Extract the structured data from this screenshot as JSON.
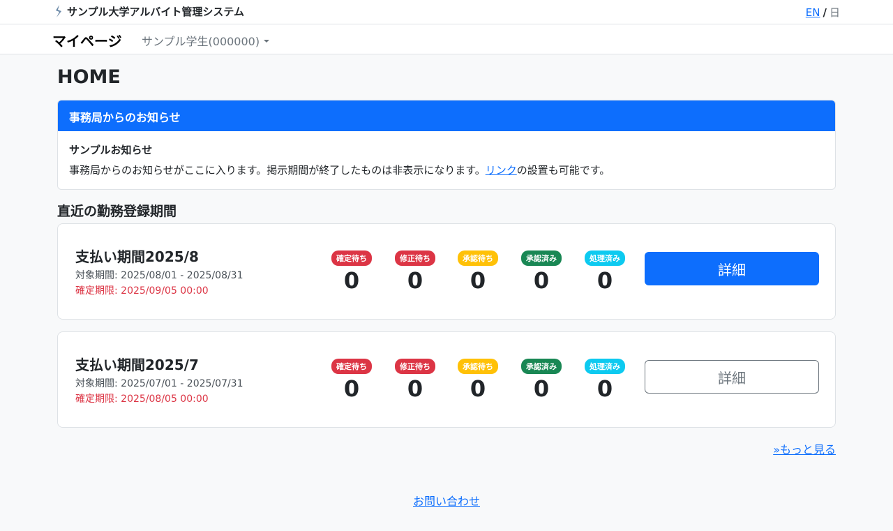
{
  "header": {
    "app_title": "サンプル大学アルバイト管理システム",
    "lang_en": "EN",
    "lang_sep": "/",
    "lang_jp": "日"
  },
  "nav": {
    "title": "マイページ",
    "user": "サンプル学生(000000)"
  },
  "page": {
    "title": "HOME"
  },
  "notice": {
    "header": "事務局からのお知らせ",
    "title": "サンプルお知らせ",
    "text_before": "事務局からのお知らせがここに入ります。掲示期間が終了したものは非表示になります。",
    "link_text": "リンク",
    "text_after": "の設置も可能です。"
  },
  "section": {
    "title": "直近の勤務登録期間"
  },
  "periods": [
    {
      "name": "支払い期間2025/8",
      "range": "対象期間: 2025/08/01 - 2025/08/31",
      "deadline": "確定期限: 2025/09/05 00:00",
      "statuses": [
        {
          "label": "確定待ち",
          "count": "0"
        },
        {
          "label": "修正待ち",
          "count": "0"
        },
        {
          "label": "承認待ち",
          "count": "0"
        },
        {
          "label": "承認済み",
          "count": "0"
        },
        {
          "label": "処理済み",
          "count": "0"
        }
      ],
      "detail_label": "詳細"
    },
    {
      "name": "支払い期間2025/7",
      "range": "対象期間: 2025/07/01 - 2025/07/31",
      "deadline": "確定期限: 2025/08/05 00:00",
      "statuses": [
        {
          "label": "確定待ち",
          "count": "0"
        },
        {
          "label": "修正待ち",
          "count": "0"
        },
        {
          "label": "承認待ち",
          "count": "0"
        },
        {
          "label": "承認済み",
          "count": "0"
        },
        {
          "label": "処理済み",
          "count": "0"
        }
      ],
      "detail_label": "詳細"
    }
  ],
  "status_colors": [
    "#dc3545",
    "#dc3545",
    "#ffc107",
    "#198754",
    "#0dcaf0"
  ],
  "footer": {
    "more_link": "»もっと見る",
    "contact_link": "お問い合わせ"
  }
}
